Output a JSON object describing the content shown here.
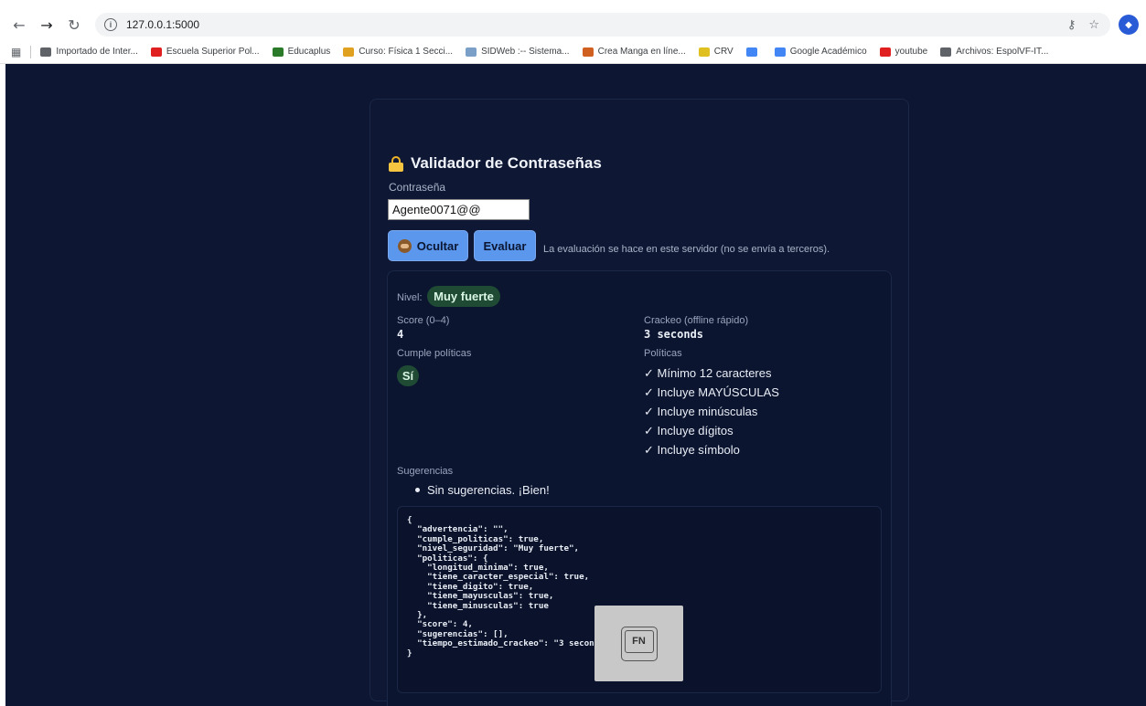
{
  "browser": {
    "url": "127.0.0.1:5000",
    "bookmarks": [
      {
        "label": "Importado de Inter...",
        "color": "#5f6368",
        "icon": "folder-icon"
      },
      {
        "label": "Escuela Superior Pol...",
        "color": "#e02020",
        "icon": "youtube-icon"
      },
      {
        "label": "Educaplus",
        "color": "#2a7a2a",
        "icon": "educaplus-icon"
      },
      {
        "label": "Curso: Física 1 Secci...",
        "color": "#e0a020",
        "icon": "moodle-icon"
      },
      {
        "label": "SIDWeb :-- Sistema...",
        "color": "#7aa0c8",
        "icon": "sidweb-icon"
      },
      {
        "label": "Crea Manga en líne...",
        "color": "#d06020",
        "icon": "manga-icon"
      },
      {
        "label": "CRV",
        "color": "#e0c020",
        "icon": "crv-icon"
      },
      {
        "label": "",
        "color": "#4285f4",
        "icon": "google-icon"
      },
      {
        "label": "Google Académico",
        "color": "#4285f4",
        "icon": "scholar-icon"
      },
      {
        "label": "youtube",
        "color": "#e02020",
        "icon": "youtube-icon"
      },
      {
        "label": "Archivos: EspolVF-IT...",
        "color": "#5f6368",
        "icon": "sharepoint-icon"
      }
    ]
  },
  "app": {
    "title": "Validador de Contraseñas",
    "password_label": "Contraseña",
    "password_value": "Agente0071@@",
    "hide_button": "Ocultar",
    "evaluate_button": "Evaluar",
    "note": "La evaluación se hace en este servidor (no se envía a terceros)."
  },
  "result": {
    "level_label": "Nivel:",
    "level_value": "Muy fuerte",
    "score_label": "Score (0–4)",
    "score_value": "4",
    "crack_label": "Crackeo (offline rápido)",
    "crack_value": "3 seconds",
    "policies_ok_label": "Cumple políticas",
    "policies_ok_value": "Sí",
    "policies_label": "Políticas",
    "policies": [
      "✓ Mínimo 12 caracteres",
      "✓ Incluye MAYÚSCULAS",
      "✓ Incluye minúsculas",
      "✓ Incluye dígitos",
      "✓ Incluye símbolo"
    ],
    "suggestions_label": "Sugerencias",
    "suggestion": "Sin sugerencias. ¡Bien!",
    "json_text": "{\n  \"advertencia\": \"\",\n  \"cumple_politicas\": true,\n  \"nivel_seguridad\": \"Muy fuerte\",\n  \"politicas\": {\n    \"longitud_minima\": true,\n    \"tiene_caracter_especial\": true,\n    \"tiene_digito\": true,\n    \"tiene_mayusculas\": true,\n    \"tiene_minusculas\": true\n  },\n  \"score\": 4,\n  \"sugerencias\": [],\n  \"tiempo_estimado_crackeo\": \"3 seconds\"\n}"
  },
  "overlay": {
    "key_label": "FN"
  }
}
